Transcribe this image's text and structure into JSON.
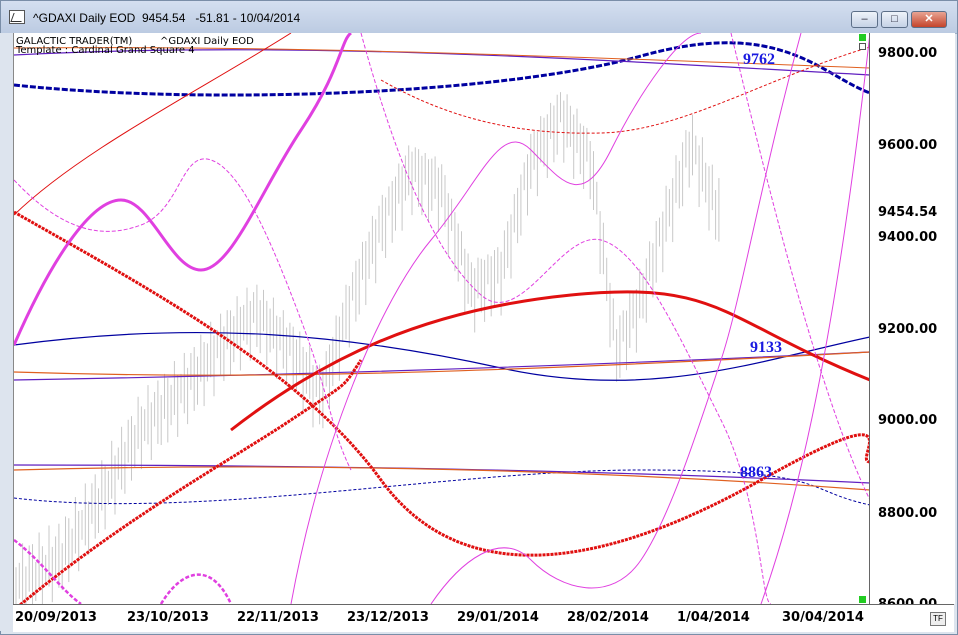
{
  "window": {
    "title": "^GDAXI Daily EOD  9454.54   -51.81 - 10/04/2014",
    "minimize_label": "–",
    "maximize_label": "□",
    "close_label": "✕"
  },
  "chart_header": {
    "line1_left": "GALACTIC TRADER(TM)",
    "line1_right": "^GDAXI Daily EOD",
    "line2": "Template : Cardinal Grand Square 4"
  },
  "annotations": [
    "9762",
    "9133",
    "8863"
  ],
  "tf_label": "TF",
  "colors": {
    "bars": "#c8c8c8",
    "magenta": "#e040e0",
    "red": "#e01010",
    "blue": "#1010c0",
    "navy": "#0000a0",
    "purple": "#6020c0",
    "orange": "#e06020"
  },
  "chart_data": {
    "type": "line",
    "title": "^GDAXI Daily EOD",
    "last_value": "9454.54",
    "y_ticks": [
      "9800.00",
      "9600.00",
      "9454.54",
      "9400.00",
      "9200.00",
      "9000.00",
      "8800.00",
      "8600.00"
    ],
    "x_ticks": [
      "20/09/2013",
      "23/10/2013",
      "22/11/2013",
      "23/12/2013",
      "29/01/2014",
      "28/02/2014",
      "1/04/2014",
      "30/04/2014"
    ],
    "ylim": [
      8600,
      9840
    ],
    "price_levels": [
      9762,
      9133,
      8863
    ],
    "grid": false
  }
}
